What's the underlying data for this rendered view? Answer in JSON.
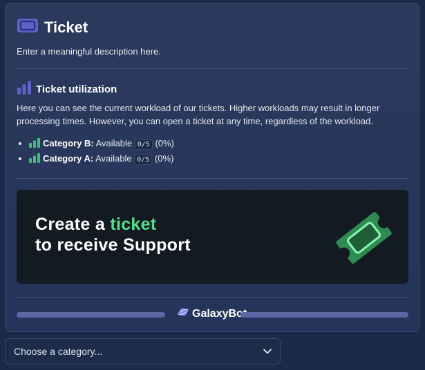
{
  "embed": {
    "title": "Ticket",
    "description": "Enter a meaningful description here.",
    "section_title": "Ticket utilization",
    "section_text": "Here you can see the current workload of our tickets. Higher workloads may result in longer processing times. However, you can open a ticket at any time, regardless of the workload.",
    "categories": [
      {
        "name": "Category B:",
        "status": "Available",
        "count": "0/5",
        "percent": "(0%)"
      },
      {
        "name": "Category A:",
        "status": "Available",
        "count": "0/5",
        "percent": "(0%)"
      }
    ],
    "banner": {
      "line1_prefix": "Create a ",
      "line1_highlight": "ticket",
      "line2": "to receive Support",
      "highlight_color": "#4fe08a"
    },
    "footer_brand": "GalaxyBot"
  },
  "select": {
    "placeholder": "Choose a category..."
  },
  "icons": {
    "title": "ticket-icon",
    "section": "bar-chart-icon",
    "category": "signal-bars-icon",
    "brand": "planet-icon",
    "dropdown": "chevron-down-icon"
  }
}
